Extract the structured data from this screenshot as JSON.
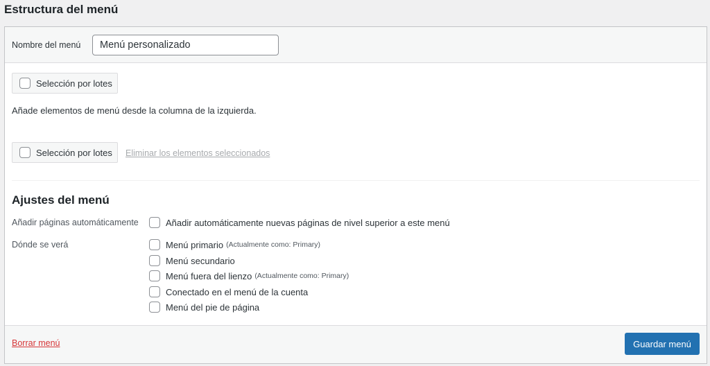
{
  "title": "Estructura del menú",
  "menu_name": {
    "label": "Nombre del menú",
    "value": "Menú personalizado"
  },
  "bulk_select_label": "Selección por lotes",
  "help_text": "Añade elementos de menú desde la columna de la izquierda.",
  "remove_selected": "Eliminar los elementos seleccionados",
  "settings": {
    "title": "Ajustes del menú",
    "auto_add_label": "Añadir páginas automáticamente",
    "auto_add_option": "Añadir automáticamente nuevas páginas de nivel superior a este menú",
    "locations_label": "Dónde se verá",
    "locations": [
      {
        "label": "Menú primario",
        "note": "(Actualmente como: Primary)"
      },
      {
        "label": "Menú secundario",
        "note": ""
      },
      {
        "label": "Menú fuera del lienzo",
        "note": "(Actualmente como: Primary)"
      },
      {
        "label": "Conectado en el menú de la cuenta",
        "note": ""
      },
      {
        "label": "Menú del pie de página",
        "note": ""
      }
    ]
  },
  "footer": {
    "delete": "Borrar menú",
    "save": "Guardar menú"
  }
}
